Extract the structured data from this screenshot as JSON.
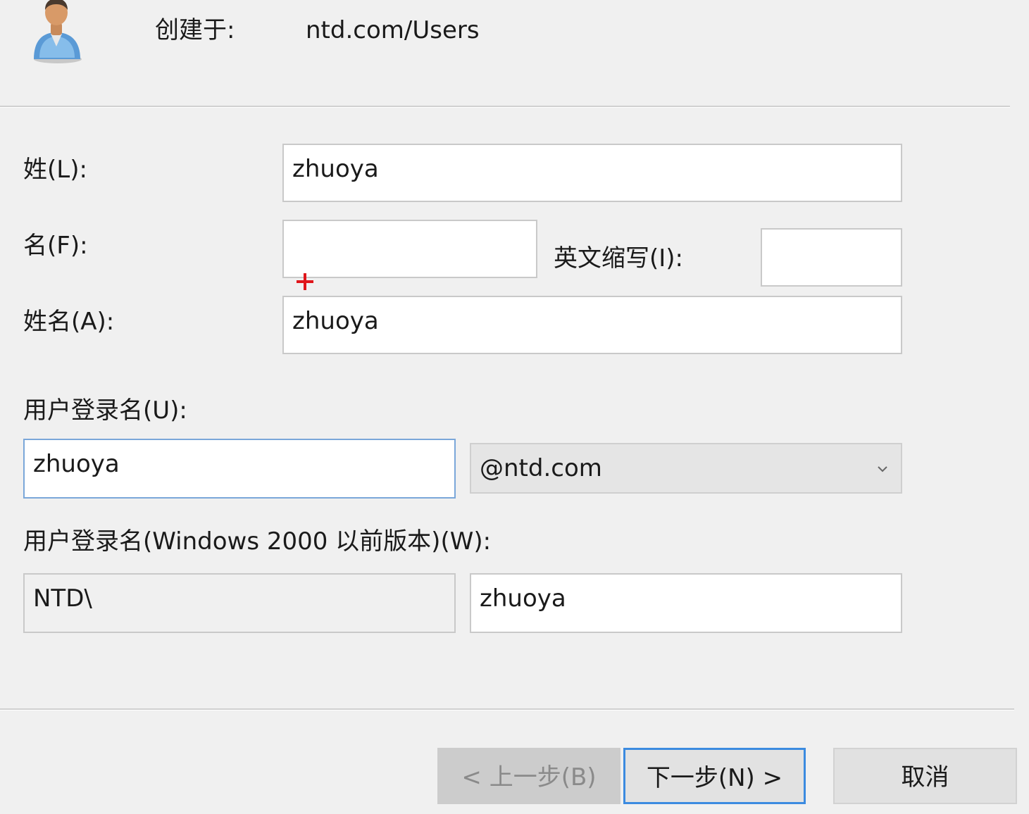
{
  "header": {
    "created_in_label": "创建于:",
    "created_in_value": "ntd.com/Users",
    "icon": "user-icon"
  },
  "form": {
    "last_name": {
      "label": "姓(L):",
      "value": "zhuoya"
    },
    "first_name": {
      "label": "名(F):",
      "value": ""
    },
    "initials": {
      "label": "英文缩写(I):",
      "value": ""
    },
    "full_name": {
      "label": "姓名(A):",
      "value": "zhuoya"
    },
    "logon_name": {
      "label": "用户登录名(U):",
      "value": "zhuoya"
    },
    "upn_suffix": {
      "selected": "@ntd.com",
      "icon": "chevron-down-icon"
    },
    "pre2000_logon": {
      "label": "用户登录名(Windows 2000 以前版本)(W):",
      "domain_prefix": "NTD\\",
      "value": "zhuoya"
    }
  },
  "buttons": {
    "back": "< 上一步(B)",
    "next": "下一步(N) >",
    "cancel": "取消"
  },
  "colors": {
    "background": "#f0f0f0",
    "focus_border": "#7aa7d9",
    "default_button_border": "#3c8be0",
    "cursor_marker": "#e0161b"
  }
}
